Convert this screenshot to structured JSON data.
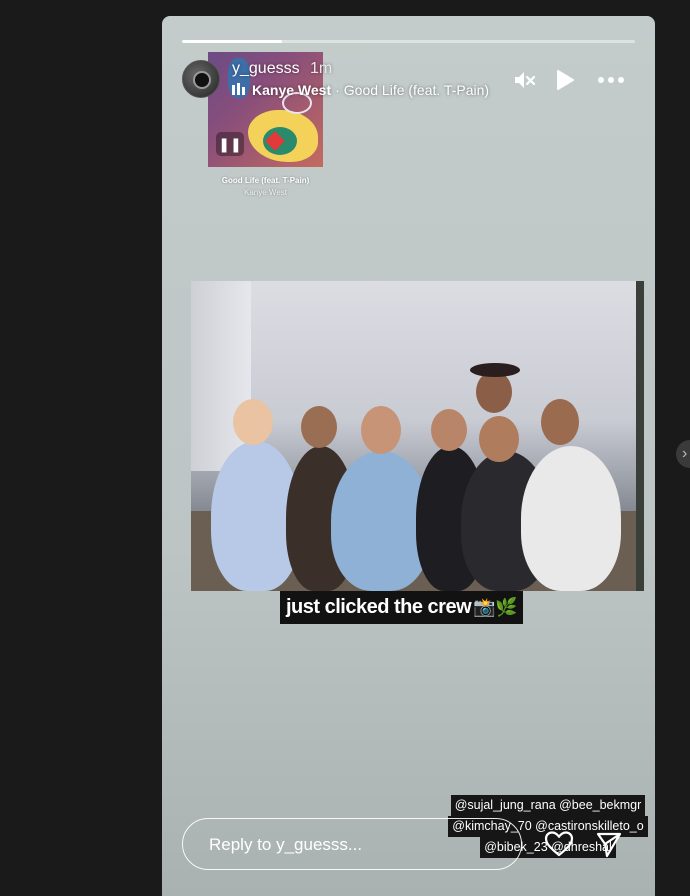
{
  "story": {
    "progress_fraction": 0.22,
    "username": "y_guesss",
    "timestamp": "1m",
    "music": {
      "artist": "Kanye West",
      "separator": "·",
      "song": "Good Life (feat. T-Pain)"
    },
    "sticker": {
      "song": "Good Life (feat. T-Pain)",
      "artist": "Kanye West"
    },
    "caption": {
      "text": "just clicked the crew",
      "emojis": "📸🌿"
    },
    "mentions": [
      "@sujal_jung_rana @bee_bekmgr",
      "@kimchay_70 @castironskilleto_o",
      "@bibek_23 @dhreshal"
    ],
    "reply": {
      "placeholder": "Reply to y_guesss..."
    },
    "icons": {
      "mute": "mute-icon",
      "play": "play-icon",
      "more": "more-icon",
      "heart": "heart-icon",
      "send": "send-icon"
    }
  }
}
